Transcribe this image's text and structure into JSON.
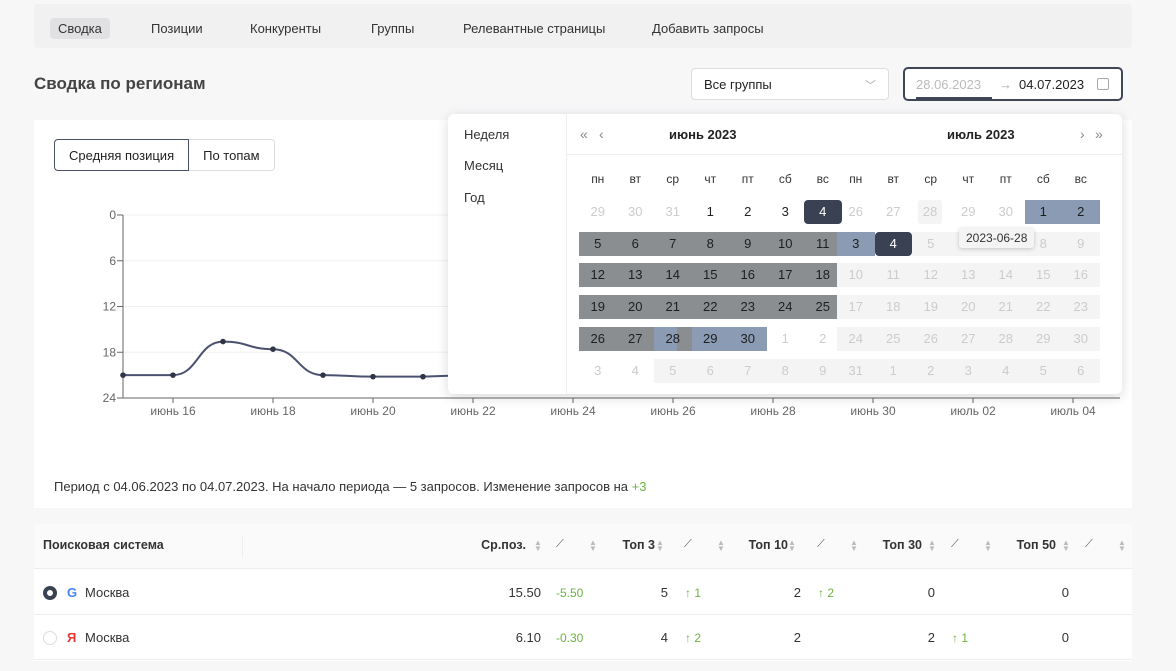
{
  "nav": {
    "tabs": [
      "Сводка",
      "Позиции",
      "Конкуренты",
      "Группы",
      "Релевантные страницы",
      "Добавить запросы"
    ],
    "active": 0
  },
  "page_title": "Сводка по регионам",
  "group_select": {
    "value": "Все группы"
  },
  "date_range": {
    "start": "28.06.2023",
    "end": "04.07.2023",
    "arrow": "→"
  },
  "view_toggle": {
    "options": [
      "Средняя позиция",
      "По топам"
    ],
    "active": 0
  },
  "chart_data": {
    "type": "line",
    "x": [
      "2023-06-15",
      "2023-06-16",
      "2023-06-17",
      "2023-06-18",
      "2023-06-19",
      "2023-06-20",
      "2023-06-21"
    ],
    "series": [
      {
        "values": [
          21,
          21,
          16.6,
          17.6,
          21,
          21.2,
          21.2
        ]
      }
    ],
    "y_ticks": [
      "0",
      "6",
      "12",
      "18",
      "24"
    ],
    "ylim": [
      24,
      0
    ],
    "y_inverted": true,
    "x_ticks": [
      "июнь 16",
      "июнь 18",
      "июнь 20",
      "июнь 22",
      "июнь 24",
      "июнь 26",
      "июнь 28",
      "июнь 30",
      "июль 02",
      "июль 04"
    ],
    "grid": true,
    "line_color": "#4a5270"
  },
  "summary": {
    "text": "Период с 04.06.2023 по 04.07.2023. На начало периода — 5 запросов. Изменение запросов на ",
    "delta": "+3"
  },
  "datepicker": {
    "presets": [
      "Неделя",
      "Месяц",
      "Год"
    ],
    "left_title": "июнь  2023",
    "right_title": "июль  2023",
    "weekdays": [
      "пн",
      "вт",
      "ср",
      "чт",
      "пт",
      "сб",
      "вс"
    ],
    "tooltip": "2023-06-28",
    "left_cells": [
      [
        "29",
        "m"
      ],
      [
        "30",
        "m"
      ],
      [
        "31",
        "m"
      ],
      [
        "1",
        "n"
      ],
      [
        "2",
        "n"
      ],
      [
        "3",
        "n"
      ],
      [
        "4",
        "s"
      ],
      [
        "5",
        "r"
      ],
      [
        "6",
        "r"
      ],
      [
        "7",
        "r"
      ],
      [
        "8",
        "r"
      ],
      [
        "9",
        "r"
      ],
      [
        "10",
        "r"
      ],
      [
        "11",
        "r"
      ],
      [
        "12",
        "r"
      ],
      [
        "13",
        "r"
      ],
      [
        "14",
        "r"
      ],
      [
        "15",
        "r"
      ],
      [
        "16",
        "r"
      ],
      [
        "17",
        "r"
      ],
      [
        "18",
        "r"
      ],
      [
        "19",
        "r"
      ],
      [
        "20",
        "r"
      ],
      [
        "21",
        "r"
      ],
      [
        "22",
        "r"
      ],
      [
        "23",
        "r"
      ],
      [
        "24",
        "r"
      ],
      [
        "25",
        "r"
      ],
      [
        "26",
        "r"
      ],
      [
        "27",
        "r"
      ],
      [
        "28",
        "h"
      ],
      [
        "29",
        "p"
      ],
      [
        "30",
        "p"
      ],
      [
        "1",
        "m"
      ],
      [
        "2",
        "m"
      ],
      [
        "3",
        "m"
      ],
      [
        "4",
        "m"
      ],
      [
        "5",
        "d"
      ],
      [
        "6",
        "d"
      ],
      [
        "7",
        "d"
      ],
      [
        "8",
        "d"
      ],
      [
        "9",
        "d"
      ]
    ],
    "right_cells": [
      [
        "26",
        "m"
      ],
      [
        "27",
        "m"
      ],
      [
        "28",
        "x"
      ],
      [
        "29",
        "m"
      ],
      [
        "30",
        "m"
      ],
      [
        "1",
        "p"
      ],
      [
        "2",
        "p"
      ],
      [
        "3",
        "p"
      ],
      [
        "4",
        "e"
      ],
      [
        "5",
        "d"
      ],
      [
        "6",
        "d"
      ],
      [
        "7",
        "d"
      ],
      [
        "8",
        "d"
      ],
      [
        "9",
        "d"
      ],
      [
        "10",
        "d"
      ],
      [
        "11",
        "d"
      ],
      [
        "12",
        "d"
      ],
      [
        "13",
        "d"
      ],
      [
        "14",
        "d"
      ],
      [
        "15",
        "d"
      ],
      [
        "16",
        "d"
      ],
      [
        "17",
        "d"
      ],
      [
        "18",
        "d"
      ],
      [
        "19",
        "d"
      ],
      [
        "20",
        "d"
      ],
      [
        "21",
        "d"
      ],
      [
        "22",
        "d"
      ],
      [
        "23",
        "d"
      ],
      [
        "24",
        "d"
      ],
      [
        "25",
        "d"
      ],
      [
        "26",
        "d"
      ],
      [
        "27",
        "d"
      ],
      [
        "28",
        "d"
      ],
      [
        "29",
        "d"
      ],
      [
        "30",
        "d"
      ],
      [
        "31",
        "d"
      ],
      [
        "1",
        "d"
      ],
      [
        "2",
        "d"
      ],
      [
        "3",
        "d"
      ],
      [
        "4",
        "d"
      ],
      [
        "5",
        "d"
      ],
      [
        "6",
        "d"
      ]
    ]
  },
  "table": {
    "headers": {
      "engine": "Поисковая система",
      "avg": "Ср.поз.",
      "top3": "Топ 3",
      "top10": "Топ 10",
      "top30": "Топ 30",
      "top50": "Топ 50"
    },
    "rows": [
      {
        "engine": "google",
        "selected": true,
        "icon": "G",
        "region": "Москва",
        "avg": "15.50",
        "avg_delta": "-5.50",
        "top3": "5",
        "top3_delta": "↑ 1",
        "top10": "2",
        "top10_delta": "↑ 2",
        "top30": "0",
        "top30_delta": "",
        "top50": "0"
      },
      {
        "engine": "yandex",
        "selected": false,
        "icon": "Я",
        "region": "Москва",
        "avg": "6.10",
        "avg_delta": "-0.30",
        "top3": "4",
        "top3_delta": "↑ 2",
        "top10": "2",
        "top10_delta": "",
        "top30": "2",
        "top30_delta": "↑ 1",
        "top50": "0"
      }
    ]
  }
}
